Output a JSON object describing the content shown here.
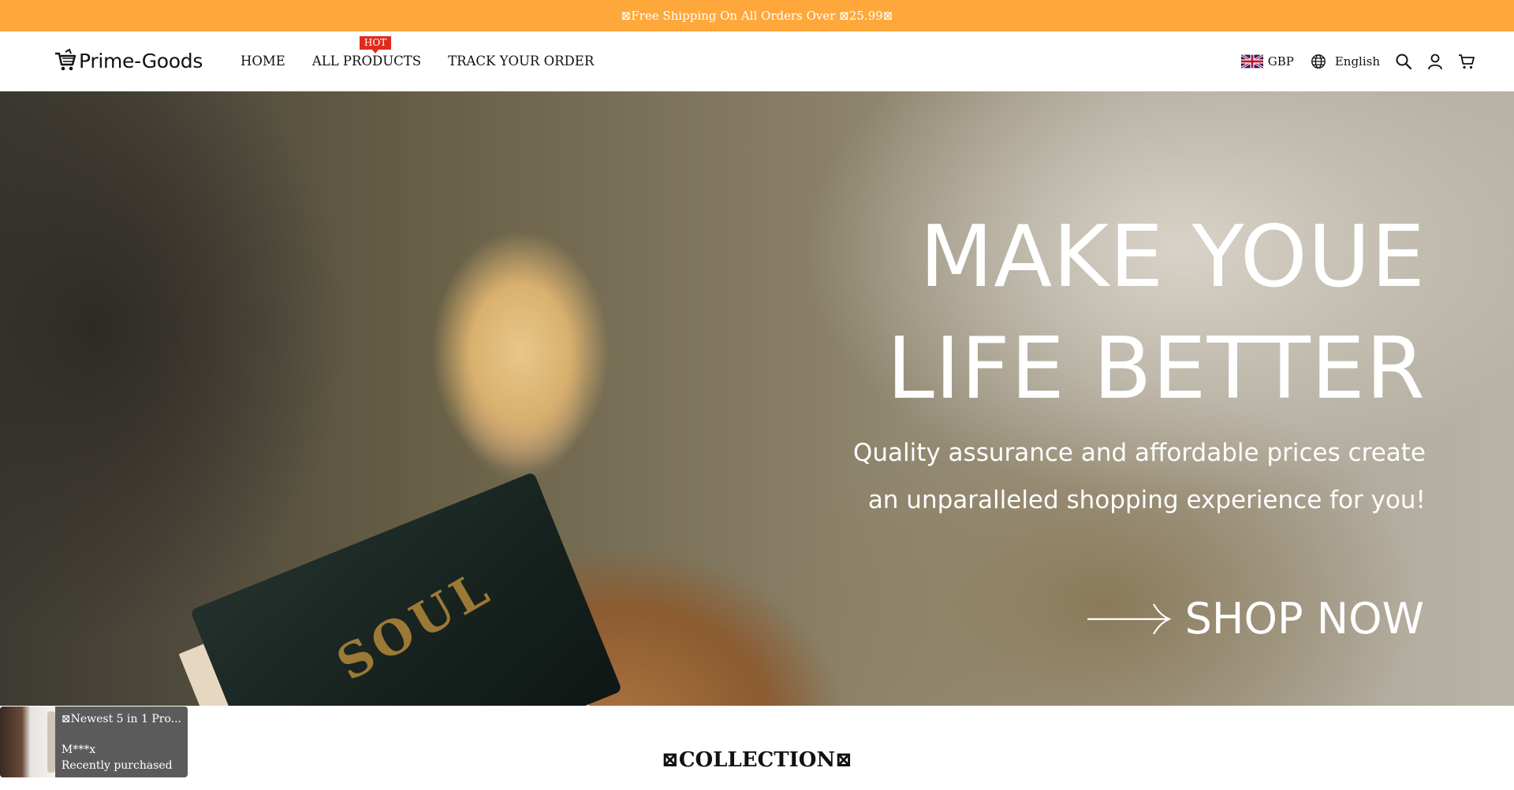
{
  "announcement": {
    "text": "⊠Free Shipping On All Orders Over ⊠25.99⊠"
  },
  "header": {
    "logo_text": "Prime-Goods",
    "nav": [
      {
        "label": "HOME"
      },
      {
        "label": "ALL PRODUCTS",
        "badge": "HOT"
      },
      {
        "label": "TRACK YOUR ORDER"
      }
    ],
    "currency": "GBP",
    "language": "English",
    "icons": [
      "uk-flag-icon",
      "globe-icon",
      "search-icon",
      "account-icon",
      "cart-icon"
    ]
  },
  "hero": {
    "line1": "MAKE YOUE",
    "line2": "LIFE BETTER",
    "sub1": "Quality assurance and affordable prices create",
    "sub2": "an unparalleled shopping experience for you!",
    "cta": "SHOP NOW",
    "book_text": "SOUL"
  },
  "popup": {
    "product": "⊠Newest 5 in 1 Pro...",
    "buyer": "M***x",
    "status": "Recently purchased"
  },
  "collection": {
    "title": "⊠COLLECTION⊠"
  },
  "colors": {
    "announcement_bg": "#fea83c",
    "hot_badge": "#e12b1d",
    "popup_bg": "#5b5b5b"
  }
}
